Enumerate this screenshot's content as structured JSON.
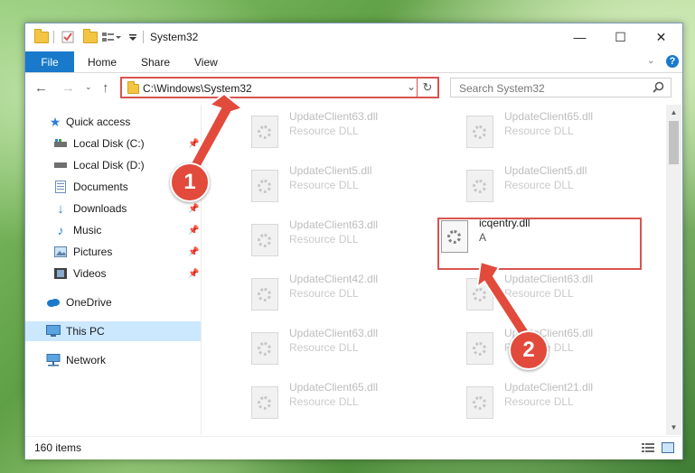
{
  "window": {
    "title": "System32",
    "controls": {
      "minimize": "—",
      "maximize": "☐",
      "close": "✕"
    }
  },
  "ribbon": {
    "tabs": [
      "File",
      "Home",
      "Share",
      "View"
    ]
  },
  "address_bar": {
    "path": "C:\\Windows\\System32",
    "search_placeholder": "Search System32"
  },
  "sidebar": {
    "items": [
      {
        "label": "Quick access",
        "icon": "star-icon"
      },
      {
        "label": "Local Disk (C:)",
        "icon": "drive-icon",
        "pinned": true
      },
      {
        "label": "Local Disk (D:)",
        "icon": "drive-icon",
        "pinned": false
      },
      {
        "label": "Documents",
        "icon": "document-icon",
        "pinned": true
      },
      {
        "label": "Downloads",
        "icon": "download-icon",
        "pinned": true
      },
      {
        "label": "Music",
        "icon": "music-icon",
        "pinned": true
      },
      {
        "label": "Pictures",
        "icon": "picture-icon",
        "pinned": true
      },
      {
        "label": "Videos",
        "icon": "video-icon",
        "pinned": true
      },
      {
        "label": "OneDrive",
        "icon": "cloud-icon"
      },
      {
        "label": "This PC",
        "icon": "computer-icon",
        "selected": true
      },
      {
        "label": "Network",
        "icon": "network-icon"
      }
    ]
  },
  "files": [
    {
      "name": "UpdateClient63.dll",
      "desc": "Resource DLL"
    },
    {
      "name": "UpdateClient65.dll",
      "desc": "Resource DLL"
    },
    {
      "name": "UpdateClient5.dll",
      "desc": "Resource DLL"
    },
    {
      "name": "UpdateClient5.dll",
      "desc": "Resource DLL"
    },
    {
      "name": "UpdateClient63.dll",
      "desc": "Resource DLL"
    },
    {
      "name": "icqentry.dll",
      "desc": "A",
      "highlighted": true
    },
    {
      "name": "UpdateClient42.dll",
      "desc": "Resource DLL"
    },
    {
      "name": "UpdateClient63.dll",
      "desc": "Resource DLL"
    },
    {
      "name": "UpdateClient63.dll",
      "desc": "Resource DLL"
    },
    {
      "name": "UpdateClient65.dll",
      "desc": "Resource DLL"
    },
    {
      "name": "UpdateClient65.dll",
      "desc": "Resource DLL"
    },
    {
      "name": "UpdateClient21.dll",
      "desc": "Resource DLL"
    }
  ],
  "status": {
    "item_count": "160 items"
  },
  "annotations": [
    {
      "label": "1"
    },
    {
      "label": "2"
    }
  ],
  "colors": {
    "accent": "#1979ca",
    "highlight_red": "#d9534f",
    "selection": "#cce8ff",
    "marker": "#e24a3b"
  }
}
